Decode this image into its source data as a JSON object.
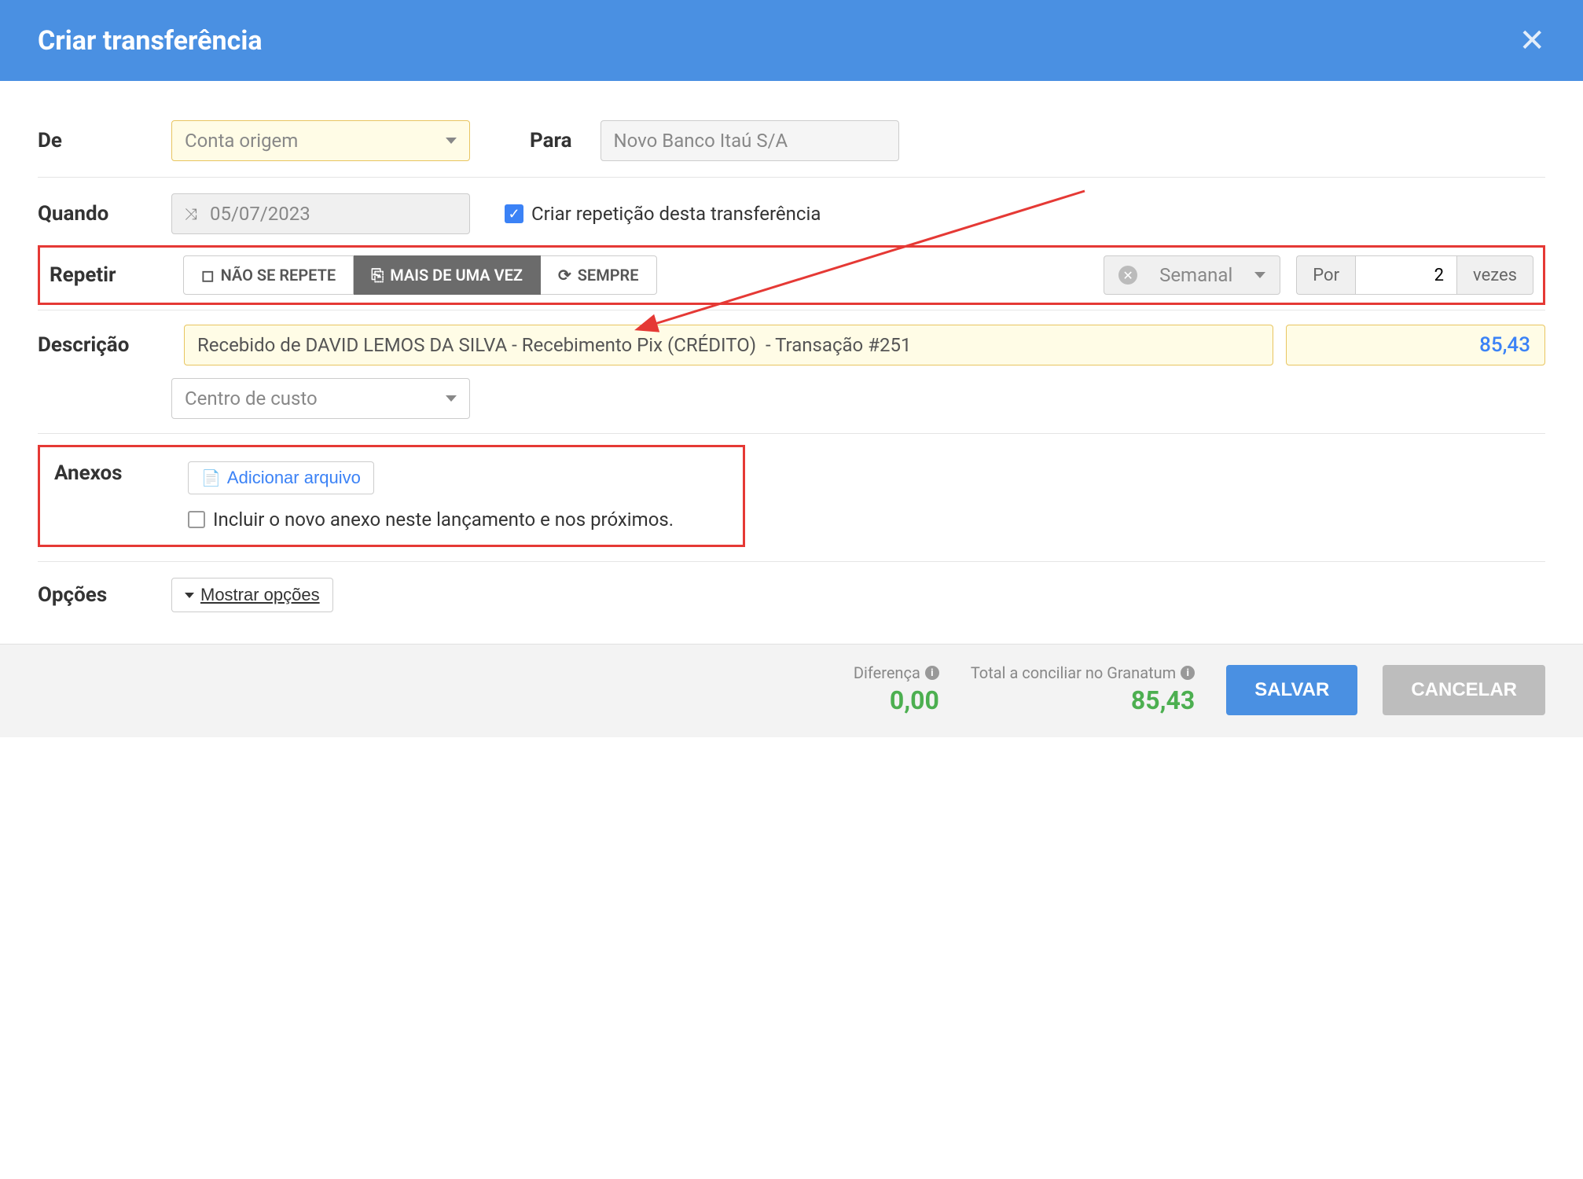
{
  "header": {
    "title": "Criar transferência"
  },
  "form": {
    "de_label": "De",
    "de_placeholder": "Conta origem",
    "para_label": "Para",
    "para_value": "Novo Banco Itaú S/A",
    "quando_label": "Quando",
    "quando_value": "05/07/2023",
    "repeat_checkbox_label": "Criar repetição desta transferência",
    "repetir_label": "Repetir",
    "repeat_options": {
      "none": "NÃO SE REPETE",
      "multi": "MAIS DE UMA VEZ",
      "always": "SEMPRE"
    },
    "frequency": "Semanal",
    "por_label": "Por",
    "por_value": "2",
    "vezes_label": "vezes",
    "descricao_label": "Descrição",
    "descricao_value": "Recebido de DAVID LEMOS DA SILVA - Recebimento Pix (CRÉDITO)  - Transação #251",
    "amount_value": "85,43",
    "centro_custo_placeholder": "Centro de custo",
    "anexos_label": "Anexos",
    "add_file_label": "Adicionar arquivo",
    "include_anexo_label": "Incluir o novo anexo neste lançamento e nos próximos.",
    "opcoes_label": "Opções",
    "mostrar_opcoes": "Mostrar opções"
  },
  "footer": {
    "diferenca_label": "Diferença",
    "diferenca_value": "0,00",
    "total_label": "Total a conciliar no Granatum",
    "total_value": "85,43",
    "save_label": "SALVAR",
    "cancel_label": "CANCELAR"
  }
}
